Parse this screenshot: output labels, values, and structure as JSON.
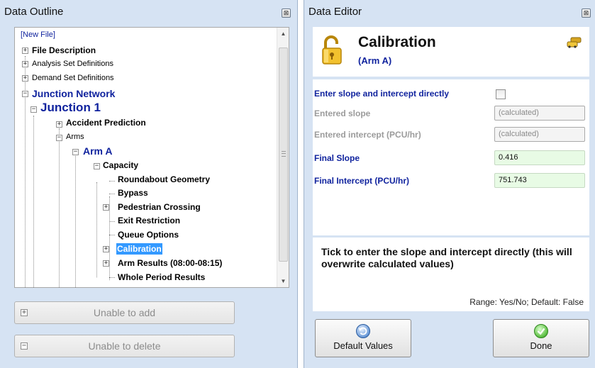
{
  "outline": {
    "title": "Data Outline",
    "close_glyph": "⊠",
    "tree": {
      "new_file": "[New File]",
      "file_description": "File Description",
      "analysis_set_definitions": "Analysis Set Definitions",
      "demand_set_definitions": "Demand Set Definitions",
      "junction_network": "Junction Network",
      "junction_1": "Junction 1",
      "accident_prediction": "Accident Prediction",
      "arms": "Arms",
      "arm_a": "Arm A",
      "capacity": "Capacity",
      "roundabout_geometry": "Roundabout Geometry",
      "bypass": "Bypass",
      "pedestrian_crossing": "Pedestrian Crossing",
      "exit_restriction": "Exit Restriction",
      "queue_options": "Queue Options",
      "calibration": "Calibration",
      "arm_results": "Arm Results (08:00-08:15)",
      "whole_period_results": "Whole Period Results"
    },
    "add_button": "Unable to add",
    "delete_button": "Unable to delete"
  },
  "editor": {
    "title": "Data Editor",
    "close_glyph": "⊠",
    "header_title": "Calibration",
    "header_subtitle": "(Arm A)",
    "fields": {
      "direct_label": "Enter slope and intercept directly",
      "direct_checked": false,
      "entered_slope_label": "Entered slope",
      "entered_slope_value": "(calculated)",
      "entered_intercept_label": "Entered intercept (PCU/hr)",
      "entered_intercept_value": "(calculated)",
      "final_slope_label": "Final Slope",
      "final_slope_value": "0.416",
      "final_intercept_label": "Final Intercept (PCU/hr)",
      "final_intercept_value": "751.743"
    },
    "help_text": "Tick to enter the slope and intercept directly (this will overwrite calculated values)",
    "help_range": "Range: Yes/No; Default: False",
    "default_button": "Default Values",
    "done_button": "Done"
  },
  "colors": {
    "panel_bg": "#d6e3f3",
    "accent_blue": "#10239e",
    "selection": "#3399ff",
    "value_field": "#e8fbe5"
  }
}
